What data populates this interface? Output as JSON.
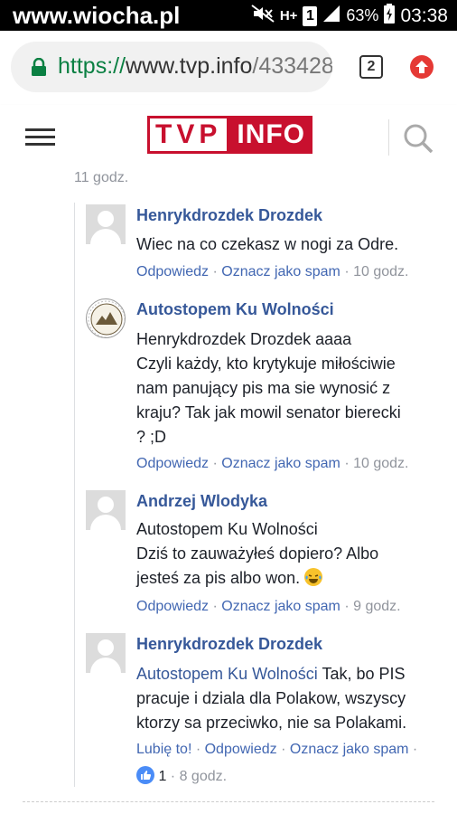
{
  "statusbar": {
    "watermark": "www.wiocha.pl",
    "network": "H+",
    "sim": "1",
    "battery": "63%",
    "time": "03:38"
  },
  "browser": {
    "url_scheme": "https://",
    "url_host": "www.tvp.info",
    "url_path": "/433428",
    "tab_count": "2"
  },
  "site": {
    "logo_tvp": "TVP",
    "logo_info": "INFO",
    "brand_color": "#c8102e"
  },
  "thread": {
    "parent_time": "11 godz.",
    "comments": [
      {
        "author": "Henrykdrozdek Drozdek",
        "lines": [
          "Wiec na co czekasz w nogi za Odre."
        ],
        "reply": "Odpowiedz",
        "spam": "Oznacz jako spam",
        "time": "10 godz."
      },
      {
        "author": "Autostopem Ku Wolności",
        "lines": [
          "Henrykdrozdek Drozdek aaaa",
          "Czyli każdy, kto krytykuje miłościwie",
          "nam panujący pis ma sie wynosić z",
          "kraju? Tak jak mowil senator bierecki",
          "? ;D"
        ],
        "reply": "Odpowiedz",
        "spam": "Oznacz jako spam",
        "time": "10 godz."
      },
      {
        "author": "Andrzej Wlodyka",
        "lines": [
          "Autostopem Ku Wolności",
          "Dziś to zauważyłeś dopiero? Albo",
          "jesteś za pis albo won."
        ],
        "reply": "Odpowiedz",
        "spam": "Oznacz jako spam",
        "time": "9 godz."
      },
      {
        "author": "Henrykdrozdek Drozdek",
        "mention": "Autostopem Ku Wolności",
        "line1_rest": " Tak, bo PIS",
        "lines": [
          "pracuje i dziala dla Polakow, wszyscy",
          "ktorzy sa przeciwko, nie sa Polakami."
        ],
        "like": "Lubię to!",
        "reply": "Odpowiedz",
        "spam": "Oznacz jako spam",
        "likes_count": "1",
        "time": "8 godz."
      }
    ]
  }
}
